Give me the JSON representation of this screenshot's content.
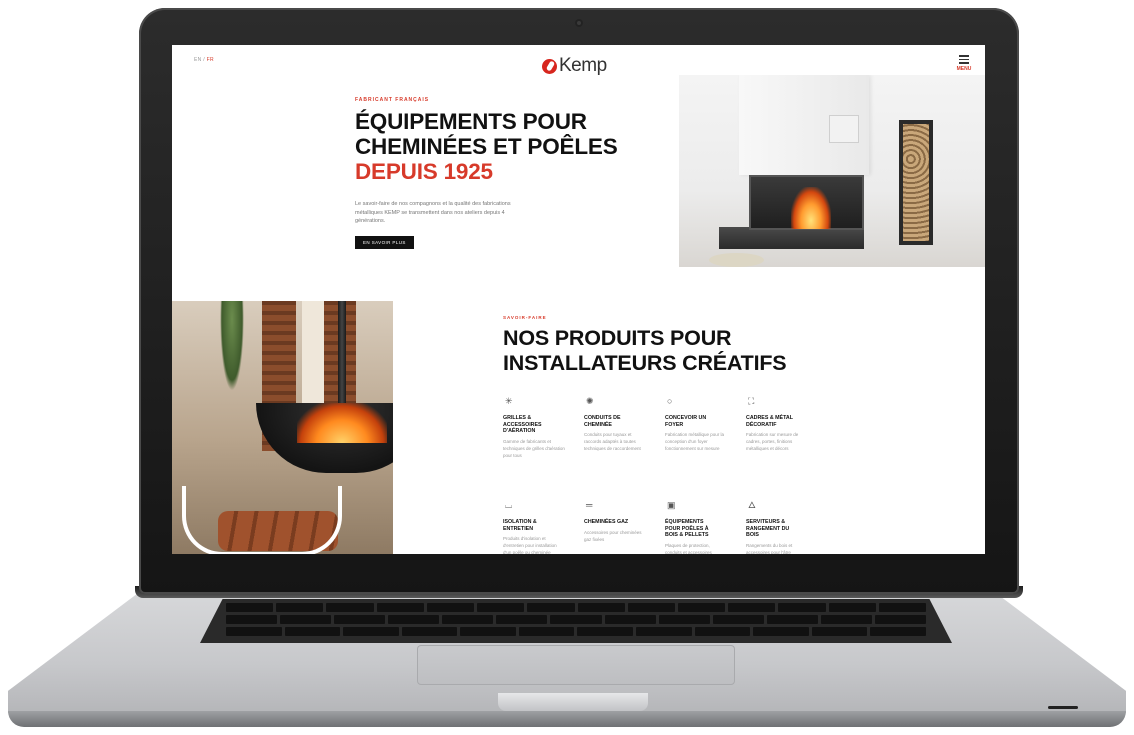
{
  "site": {
    "lang": {
      "first": "EN",
      "sep": "/",
      "active": "FR"
    },
    "logo_text": "Kemp",
    "menu_label": "MENU",
    "hero": {
      "eyebrow": "FABRICANT FRANÇAIS",
      "title_line1": "ÉQUIPEMENTS POUR",
      "title_line2": "CHEMINÉES ET POÊLES",
      "title_accent": "DEPUIS 1925",
      "body": "Le savoir-faire de nos compagnons et la qualité des fabrications métalliques KEMP se transmettent dans nos ateliers depuis 4 générations.",
      "cta": "EN SAVOIR PLUS"
    },
    "products": {
      "eyebrow": "SAVOIR-FAIRE",
      "title_line1": "NOS PRODUITS POUR",
      "title_line2": "INSTALLATEURS CRÉATIFS",
      "items": [
        {
          "icon": "grille-icon",
          "glyph": "✳",
          "title": "GRILLES & ACCESSOIRES D'AÉRATION",
          "desc": "Gamme de fabricants et techniques de grilles d'aération pour tous"
        },
        {
          "icon": "conduit-icon",
          "glyph": "✺",
          "title": "CONDUITS DE CHEMINÉE",
          "desc": "Conduits pour tuyaux et raccords adaptés à toutes techniques de raccordement"
        },
        {
          "icon": "foyer-icon",
          "glyph": "○",
          "title": "CONCEVOIR UN FOYER",
          "desc": "Fabrication métallique pour la conception d'un foyer fonctionnement sur mesure"
        },
        {
          "icon": "cadre-icon",
          "glyph": "⛶",
          "title": "CADRES & MÉTAL DÉCORATIF",
          "desc": "Fabrication sur mesure de cadres, portes, finitions métalliques et décors"
        },
        {
          "icon": "isolation-icon",
          "glyph": "⌴",
          "title": "ISOLATION & ENTRETIEN",
          "desc": "Produits d'isolation et d'entretien pour installation d'un poêle ou cheminée"
        },
        {
          "icon": "gaz-icon",
          "glyph": "═",
          "title": "CHEMINÉES GAZ",
          "desc": "Accessoires pour cheminées gaz fixées"
        },
        {
          "icon": "poele-icon",
          "glyph": "▣",
          "title": "ÉQUIPEMENTS POUR POÊLES À BOIS & PELLETS",
          "desc": "Plaques de protection, conduits et accessoires"
        },
        {
          "icon": "flame-icon",
          "glyph": "🜂",
          "title": "SERVITEURS & RANGEMENT DU BOIS",
          "desc": "Rangements du bois et accessoires pour l'âtre"
        }
      ]
    }
  },
  "colors": {
    "accent": "#d73a2a",
    "text": "#111111",
    "laptop_bezel": "#1d1d1d"
  }
}
